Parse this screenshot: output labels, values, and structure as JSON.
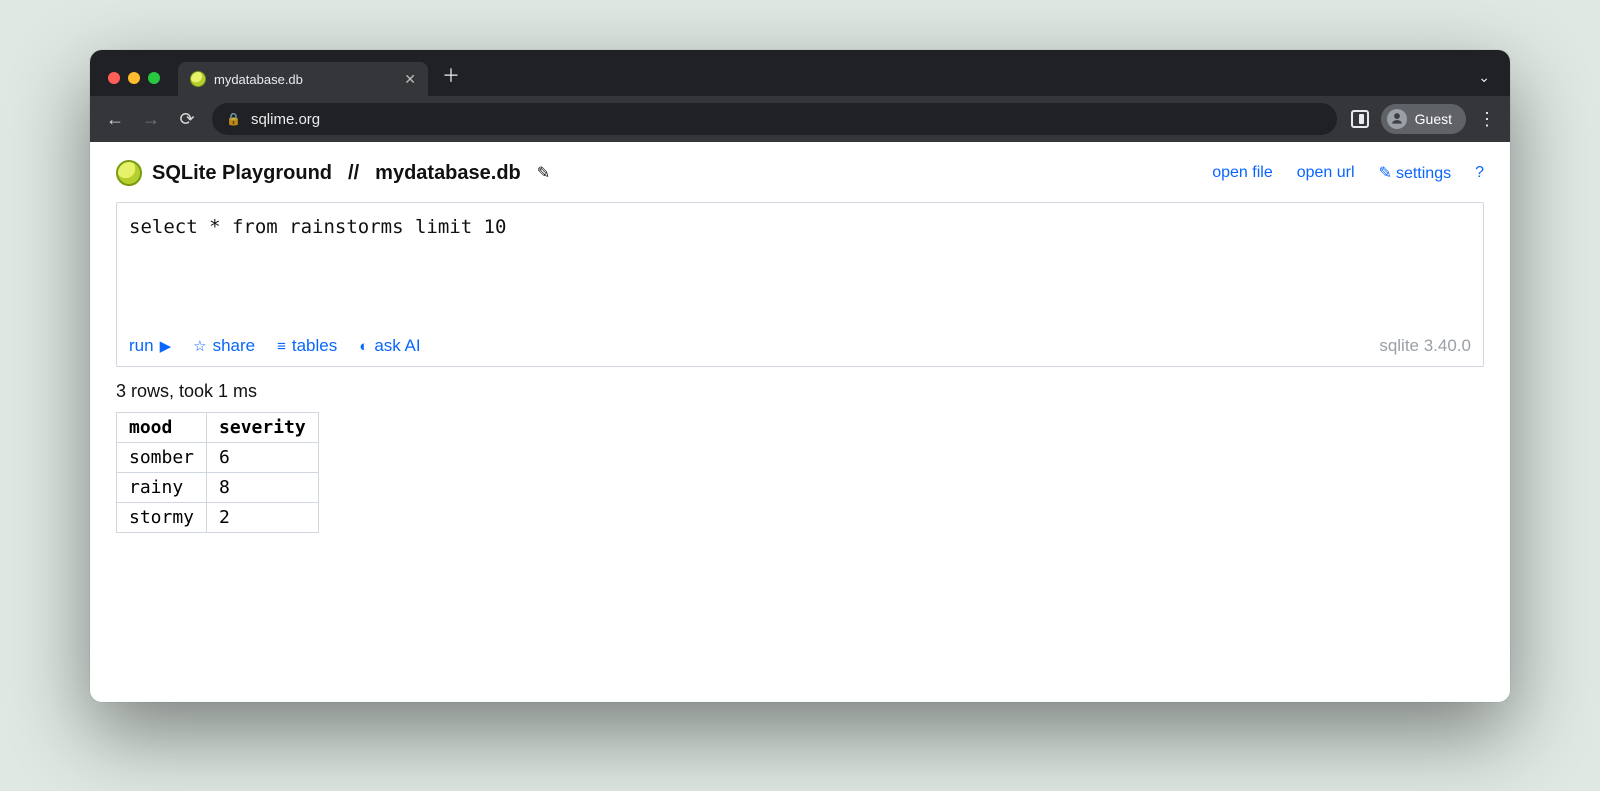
{
  "browser": {
    "tab_title": "mydatabase.db",
    "url": "sqlime.org",
    "guest_label": "Guest"
  },
  "header": {
    "app_title": "SQLite Playground",
    "separator": "//",
    "db_name": "mydatabase.db",
    "links": {
      "open_file": "open file",
      "open_url": "open url",
      "settings": "settings",
      "help": "?"
    }
  },
  "editor": {
    "sql": "select * from rainstorms limit 10",
    "actions": {
      "run": "run",
      "share": "share",
      "tables": "tables",
      "ask_ai": "ask AI"
    },
    "version": "sqlite 3.40.0"
  },
  "result": {
    "status": "3 rows, took 1 ms",
    "columns": [
      "mood",
      "severity"
    ],
    "rows": [
      {
        "mood": "somber",
        "severity": "6"
      },
      {
        "mood": "rainy",
        "severity": "8"
      },
      {
        "mood": "stormy",
        "severity": "2"
      }
    ]
  }
}
